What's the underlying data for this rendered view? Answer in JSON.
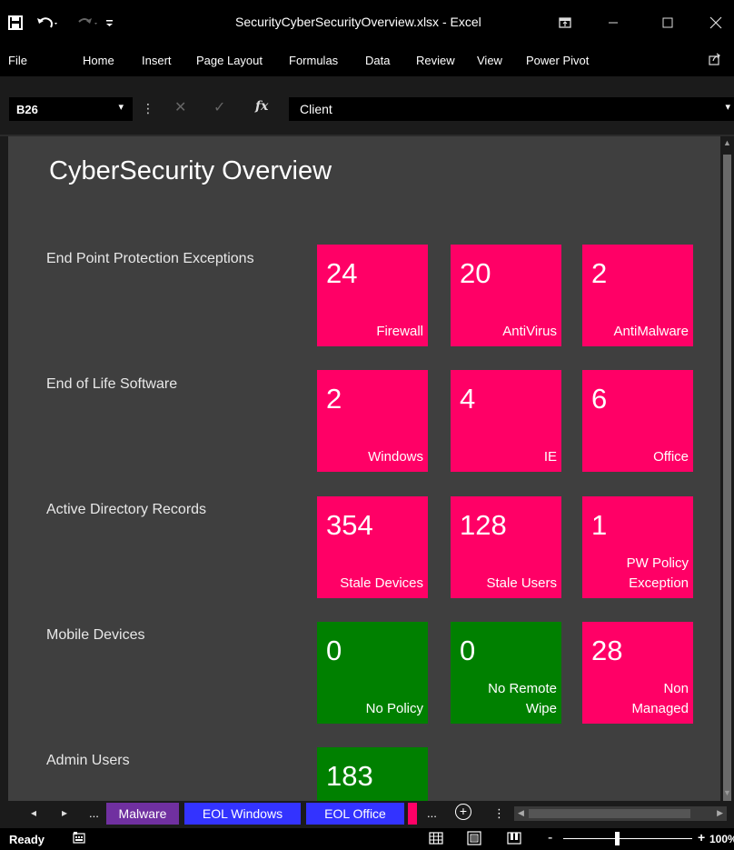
{
  "window": {
    "title": "SecurityCyberSecurityOverview.xlsx - Excel",
    "quick_access": [
      "save-icon",
      "undo-icon",
      "redo-icon",
      "customize-icon"
    ],
    "controls": [
      "ribbon-display-icon",
      "minimize-icon",
      "maximize-icon",
      "close-icon"
    ]
  },
  "ribbon": {
    "tabs": [
      "File",
      "Home",
      "Insert",
      "Page Layout",
      "Formulas",
      "Data",
      "Review",
      "View",
      "Power Pivot"
    ],
    "share_icon": "share-icon"
  },
  "formula_bar": {
    "name_box": "B26",
    "name_box_dropdown": "▾",
    "separator": "⋮",
    "cancel_glyph": "✕",
    "enter_glyph": "✓",
    "fx_glyph": "fx",
    "value": "Client",
    "expand_glyph": "▾"
  },
  "dashboard": {
    "title": "CyberSecurity Overview",
    "rows": [
      {
        "label": "End Point Protection Exceptions",
        "tiles": [
          {
            "value": "24",
            "caption": "Firewall",
            "color": "#ff0066"
          },
          {
            "value": "20",
            "caption": "AntiVirus",
            "color": "#ff0066"
          },
          {
            "value": "2",
            "caption": "AntiMalware",
            "color": "#ff0066"
          }
        ]
      },
      {
        "label": "End of Life Software",
        "tiles": [
          {
            "value": "2",
            "caption": "Windows",
            "color": "#ff0066"
          },
          {
            "value": "4",
            "caption": "IE",
            "color": "#ff0066"
          },
          {
            "value": "6",
            "caption": "Office",
            "color": "#ff0066"
          }
        ]
      },
      {
        "label": "Active Directory Records",
        "tiles": [
          {
            "value": "354",
            "caption": "Stale Devices",
            "color": "#ff0066"
          },
          {
            "value": "128",
            "caption": "Stale Users",
            "color": "#ff0066"
          },
          {
            "value": "1",
            "caption_line1": "PW Policy",
            "caption_line2": "Exception",
            "color": "#ff0066"
          }
        ]
      },
      {
        "label": "Mobile Devices",
        "tiles": [
          {
            "value": "0",
            "caption": "No Policy",
            "color": "#008000"
          },
          {
            "value": "0",
            "caption_line1": "No Remote",
            "caption_line2": "Wipe",
            "color": "#008000"
          },
          {
            "value": "28",
            "caption_line1": "Non",
            "caption_line2": "Managed",
            "color": "#ff0066"
          }
        ]
      },
      {
        "label": "Admin Users",
        "tiles": [
          {
            "value": "183",
            "caption": "",
            "color": "#008000"
          }
        ]
      }
    ]
  },
  "sheet_tabs": {
    "prev": "◂",
    "next": "▸",
    "left_ellipsis": "...",
    "tabs": [
      {
        "label": "Malware",
        "color": "#7030a0"
      },
      {
        "label": "EOL Windows",
        "color": "#3333ff"
      },
      {
        "label": "EOL Office",
        "color": "#3333ff"
      },
      {
        "label": "",
        "color": "#ff0066"
      }
    ],
    "right_ellipsis": "...",
    "add": "+",
    "more": "⋮"
  },
  "status_bar": {
    "ready": "Ready",
    "zoom": "100%",
    "minus": "-",
    "plus": "+"
  }
}
